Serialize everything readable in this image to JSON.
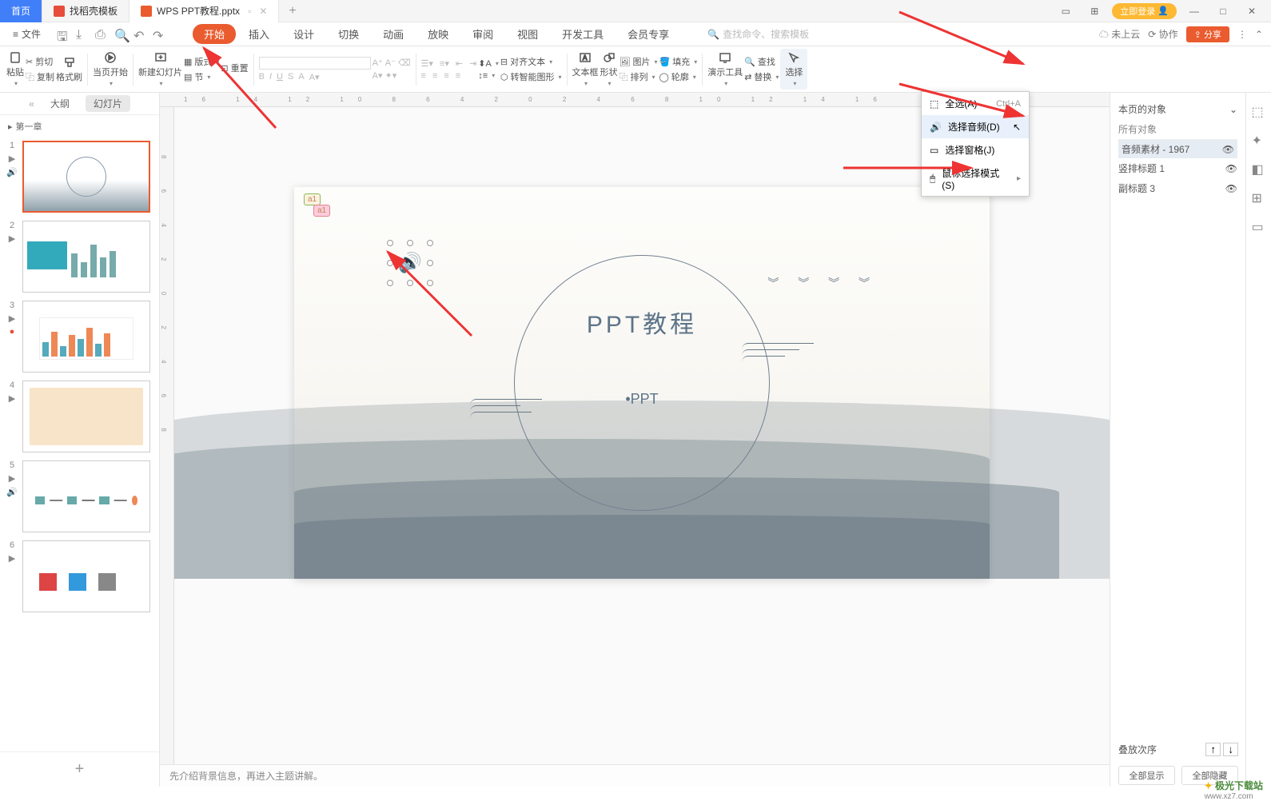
{
  "titlebar": {
    "home_tab": "首页",
    "tab2": "找稻壳模板",
    "tab3": "WPS PPT教程.pptx",
    "login": "立即登录"
  },
  "menubar": {
    "file": "文件",
    "items": [
      "开始",
      "插入",
      "设计",
      "切换",
      "动画",
      "放映",
      "审阅",
      "视图",
      "开发工具",
      "会员专享"
    ],
    "search_placeholder": "查找命令、搜索模板",
    "cloud": "未上云",
    "coop": "协作",
    "share": "分享"
  },
  "ribbon": {
    "paste": "粘贴",
    "cut": "剪切",
    "copy": "复制",
    "format_painter": "格式刷",
    "from_current": "当页开始",
    "new_slide": "新建幻灯片",
    "layout": "版式",
    "section": "节",
    "reset": "重置",
    "textbox": "文本框",
    "shape": "形状",
    "align_text": "对齐文本",
    "smart_art": "转智能图形",
    "arrange": "排列",
    "picture": "图片",
    "fill": "填充",
    "outline": "轮廓",
    "present_tools": "演示工具",
    "find": "查找",
    "replace": "替换",
    "select": "选择"
  },
  "dropdown": {
    "select_all": "全选(A)",
    "select_all_key": "Ctrl+A",
    "select_audio": "选择音频(D)",
    "select_pane": "选择窗格(J)",
    "mouse_mode": "鼠标选择模式(S)"
  },
  "slidepanel": {
    "outline": "大纲",
    "slides": "幻灯片",
    "chapter": "第一章"
  },
  "slide": {
    "title": "PPT教程",
    "sub": "•PPT"
  },
  "notes": "先介绍背景信息，再进入主题讲解。",
  "rightpanel": {
    "page_objects": "本页的对象",
    "all_objects": "所有对象",
    "item_audio": "音频素材 - 1967",
    "item_title": "竖排标题 1",
    "item_sub": "副标题 3",
    "stack_order": "叠放次序",
    "show_all": "全部显示",
    "hide_all": "全部隐藏"
  },
  "watermark": {
    "name": "极光下载站",
    "url": "www.xz7.com"
  }
}
